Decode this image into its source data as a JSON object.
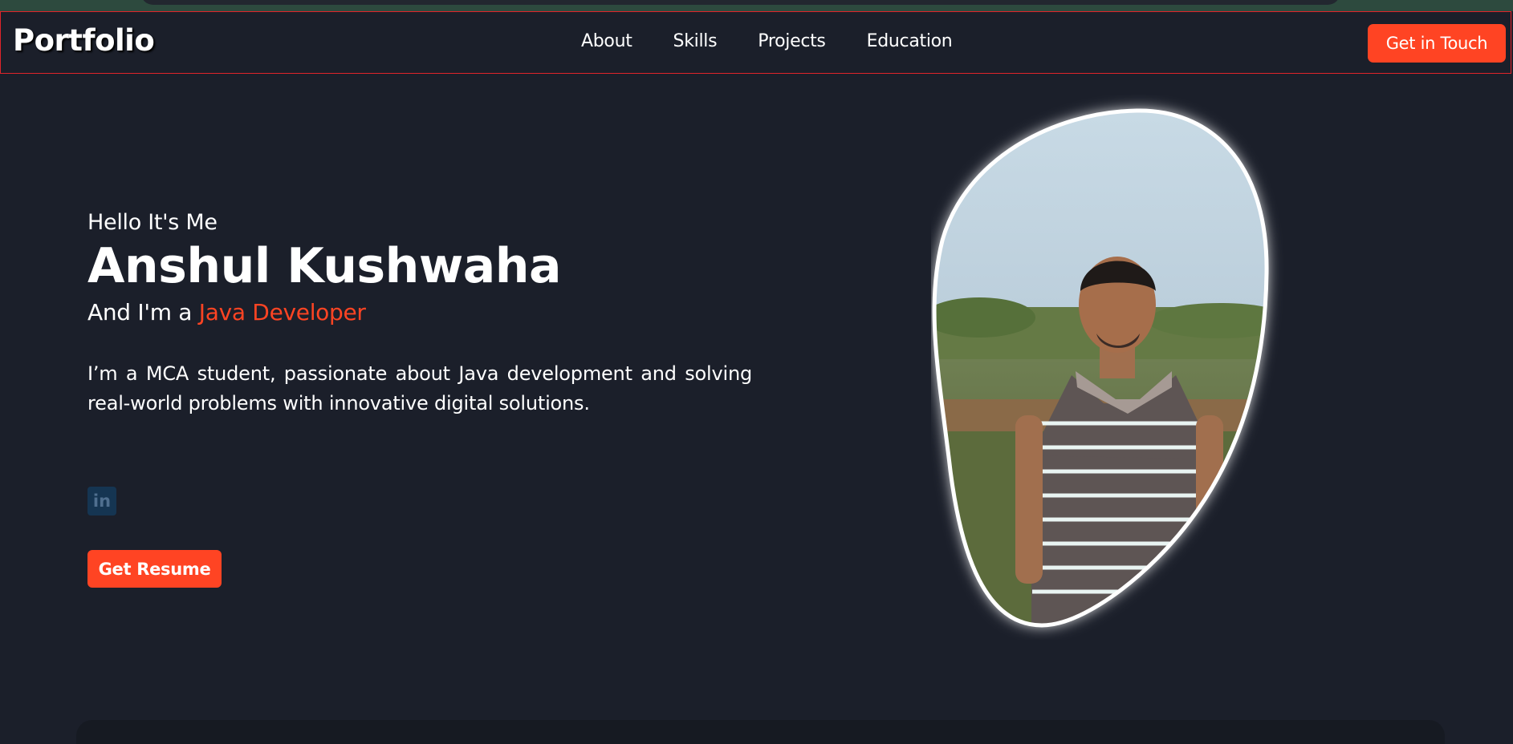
{
  "header": {
    "logo": "Portfolio",
    "nav": [
      "About",
      "Skills",
      "Projects",
      "Education"
    ],
    "cta_label": "Get in Touch"
  },
  "hero": {
    "greeting": "Hello It's Me",
    "name": "Anshul Kushwaha",
    "role_prefix": "And I'm a ",
    "role_highlight": "Java Developer",
    "description": "I’m a MCA student, passionate about Java development and solving real-world problems with innovative digital solutions.",
    "social": [
      {
        "icon": "linkedin-icon",
        "label": "in"
      }
    ],
    "resume_label": "Get Resume"
  },
  "colors": {
    "background": "#1b1f2a",
    "accent": "#ff4423",
    "nav_border": "#e0242a",
    "linkedin": "#153552"
  }
}
